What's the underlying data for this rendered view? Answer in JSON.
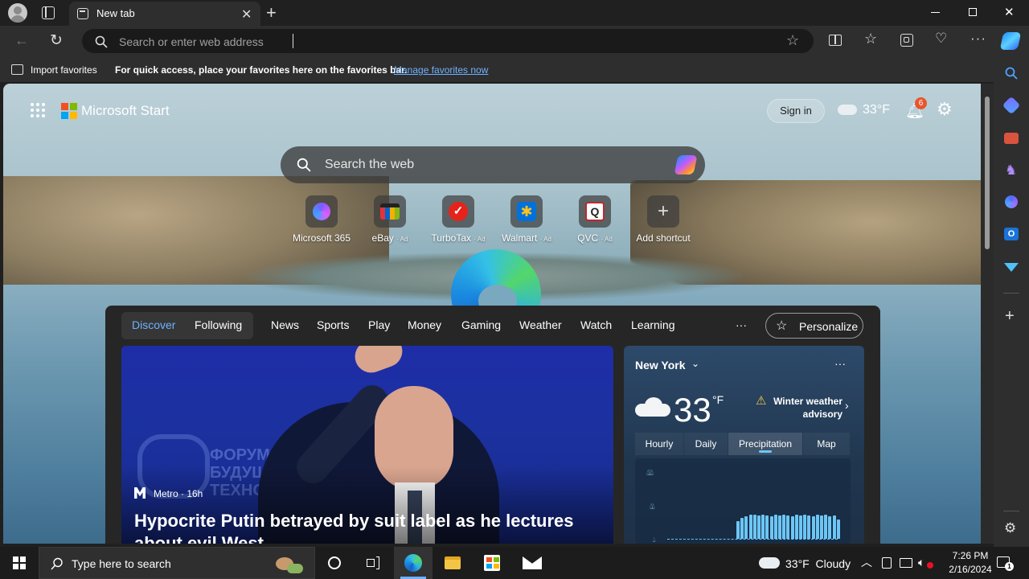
{
  "browser": {
    "tab_title": "New tab",
    "address_placeholder": "Search or enter web address"
  },
  "favorites_bar": {
    "import_label": "Import favorites",
    "hint": "For quick access, place your favorites here on the favorites bar.",
    "manage_link": "Manage favorites now"
  },
  "page": {
    "brand": "Microsoft Start",
    "sign_in": "Sign in",
    "header_temp": "33°F",
    "notification_count": "6",
    "search_placeholder": "Search the web",
    "shortcuts": [
      {
        "label": "Microsoft 365",
        "ad": ""
      },
      {
        "label": "eBay",
        "ad": "· Ad"
      },
      {
        "label": "TurboTax",
        "ad": "· Ad"
      },
      {
        "label": "Walmart",
        "ad": "· Ad"
      },
      {
        "label": "QVC",
        "ad": "· Ad"
      },
      {
        "label": "Add shortcut",
        "ad": ""
      }
    ]
  },
  "feed": {
    "tabs": [
      "Discover",
      "Following",
      "News",
      "Sports",
      "Play",
      "Money",
      "Gaming",
      "Weather",
      "Watch",
      "Learning"
    ],
    "more": "···",
    "personalize": "Personalize",
    "hero": {
      "source": "Metro · 16h",
      "headline": "Hypocrite Putin betrayed by suit label as he lectures about evil West"
    }
  },
  "weather": {
    "city": "New York",
    "temp": "33",
    "unit": "°F",
    "alert": "Winter weather advisory",
    "tabs": [
      "Hourly",
      "Daily",
      "Precipitation",
      "Map"
    ],
    "active_tab": "Precipitation",
    "precip_bars": [
      0.55,
      0.65,
      0.7,
      0.75,
      0.75,
      0.72,
      0.75,
      0.72,
      0.7,
      0.75,
      0.72,
      0.75,
      0.72,
      0.7,
      0.75,
      0.72,
      0.75,
      0.72,
      0.7,
      0.75,
      0.72,
      0.75,
      0.7,
      0.72,
      0.6
    ]
  },
  "taskbar": {
    "search_placeholder": "Type here to search",
    "weather": "33°F  Cloudy",
    "time": "7:26 PM",
    "date": "2/16/2024"
  },
  "colors": {
    "accent": "#6fb1ff",
    "link": "#6fb1ff",
    "notification": "#e8552d"
  }
}
